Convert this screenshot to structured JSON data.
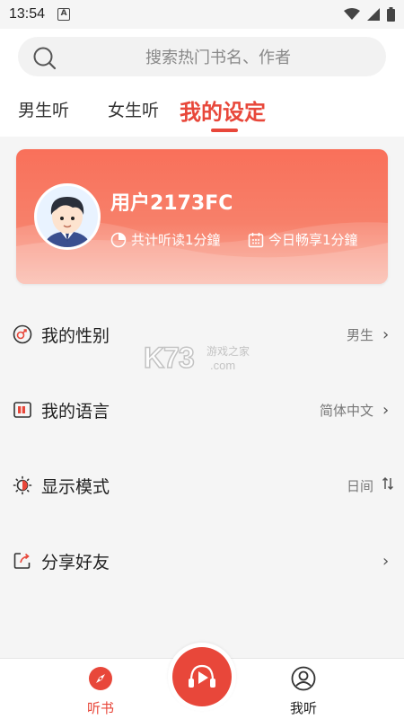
{
  "status_bar": {
    "time": "13:54",
    "notification_icon": "a-badge-icon",
    "icons": [
      "wifi-icon",
      "signal-icon",
      "battery-icon"
    ]
  },
  "search": {
    "placeholder": "搜索热门书名、作者",
    "icon": "search-icon"
  },
  "tabs": [
    {
      "label": "男生听",
      "active": false
    },
    {
      "label": "女生听",
      "active": false
    },
    {
      "label": "我的设定",
      "active": true
    }
  ],
  "profile": {
    "username": "用户2173FC",
    "avatar": "cartoon-boy-avatar",
    "stats": [
      {
        "icon": "pie-chart-icon",
        "text": "共计听读1分鐘"
      },
      {
        "icon": "calendar-icon",
        "text": "今日畅享1分鐘"
      }
    ]
  },
  "settings": [
    {
      "label": "我的性别",
      "value": "男生",
      "icon": "gender-icon",
      "action": "chevron-right-icon"
    },
    {
      "label": "我的语言",
      "value": "简体中文",
      "icon": "language-icon",
      "action": "chevron-right-icon"
    },
    {
      "label": "显示模式",
      "value": "日间",
      "icon": "brightness-icon",
      "action": "swap-icon"
    },
    {
      "label": "分享好友",
      "value": "",
      "icon": "share-icon",
      "action": "chevron-right-icon"
    }
  ],
  "watermark": {
    "logo": "K73",
    "text_cn": "游戏之家",
    "text_com": ".com"
  },
  "bottom_nav": {
    "items": [
      {
        "label": "听书",
        "icon": "compass-icon",
        "active": true
      },
      {
        "label": "我听",
        "icon": "person-icon",
        "active": false
      }
    ],
    "center_button": "play-icon"
  },
  "colors": {
    "accent": "#e8473a",
    "card_gradient_top": "#f9705a",
    "card_gradient_bottom": "#fbb3a3",
    "background": "#f5f5f5"
  }
}
